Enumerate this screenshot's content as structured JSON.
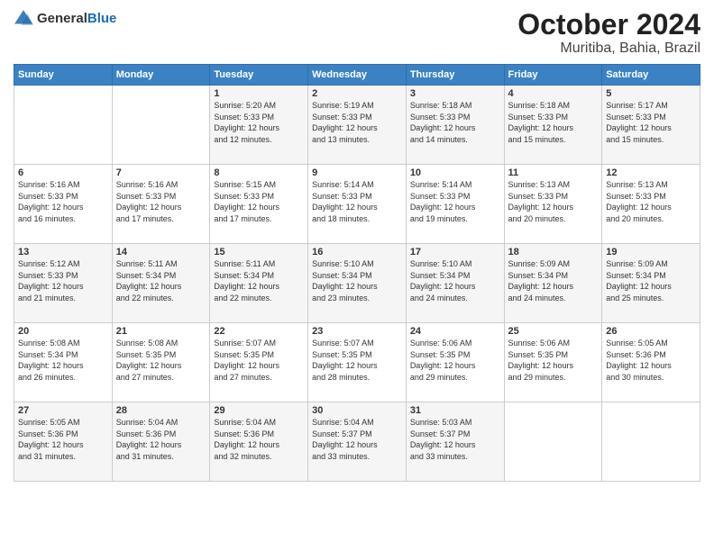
{
  "logo": {
    "text_general": "General",
    "text_blue": "Blue"
  },
  "header": {
    "month": "October 2024",
    "location": "Muritiba, Bahia, Brazil"
  },
  "days_of_week": [
    "Sunday",
    "Monday",
    "Tuesday",
    "Wednesday",
    "Thursday",
    "Friday",
    "Saturday"
  ],
  "weeks": [
    [
      {
        "day": "",
        "info": ""
      },
      {
        "day": "",
        "info": ""
      },
      {
        "day": "1",
        "info": "Sunrise: 5:20 AM\nSunset: 5:33 PM\nDaylight: 12 hours\nand 12 minutes."
      },
      {
        "day": "2",
        "info": "Sunrise: 5:19 AM\nSunset: 5:33 PM\nDaylight: 12 hours\nand 13 minutes."
      },
      {
        "day": "3",
        "info": "Sunrise: 5:18 AM\nSunset: 5:33 PM\nDaylight: 12 hours\nand 14 minutes."
      },
      {
        "day": "4",
        "info": "Sunrise: 5:18 AM\nSunset: 5:33 PM\nDaylight: 12 hours\nand 15 minutes."
      },
      {
        "day": "5",
        "info": "Sunrise: 5:17 AM\nSunset: 5:33 PM\nDaylight: 12 hours\nand 15 minutes."
      }
    ],
    [
      {
        "day": "6",
        "info": "Sunrise: 5:16 AM\nSunset: 5:33 PM\nDaylight: 12 hours\nand 16 minutes."
      },
      {
        "day": "7",
        "info": "Sunrise: 5:16 AM\nSunset: 5:33 PM\nDaylight: 12 hours\nand 17 minutes."
      },
      {
        "day": "8",
        "info": "Sunrise: 5:15 AM\nSunset: 5:33 PM\nDaylight: 12 hours\nand 17 minutes."
      },
      {
        "day": "9",
        "info": "Sunrise: 5:14 AM\nSunset: 5:33 PM\nDaylight: 12 hours\nand 18 minutes."
      },
      {
        "day": "10",
        "info": "Sunrise: 5:14 AM\nSunset: 5:33 PM\nDaylight: 12 hours\nand 19 minutes."
      },
      {
        "day": "11",
        "info": "Sunrise: 5:13 AM\nSunset: 5:33 PM\nDaylight: 12 hours\nand 20 minutes."
      },
      {
        "day": "12",
        "info": "Sunrise: 5:13 AM\nSunset: 5:33 PM\nDaylight: 12 hours\nand 20 minutes."
      }
    ],
    [
      {
        "day": "13",
        "info": "Sunrise: 5:12 AM\nSunset: 5:33 PM\nDaylight: 12 hours\nand 21 minutes."
      },
      {
        "day": "14",
        "info": "Sunrise: 5:11 AM\nSunset: 5:34 PM\nDaylight: 12 hours\nand 22 minutes."
      },
      {
        "day": "15",
        "info": "Sunrise: 5:11 AM\nSunset: 5:34 PM\nDaylight: 12 hours\nand 22 minutes."
      },
      {
        "day": "16",
        "info": "Sunrise: 5:10 AM\nSunset: 5:34 PM\nDaylight: 12 hours\nand 23 minutes."
      },
      {
        "day": "17",
        "info": "Sunrise: 5:10 AM\nSunset: 5:34 PM\nDaylight: 12 hours\nand 24 minutes."
      },
      {
        "day": "18",
        "info": "Sunrise: 5:09 AM\nSunset: 5:34 PM\nDaylight: 12 hours\nand 24 minutes."
      },
      {
        "day": "19",
        "info": "Sunrise: 5:09 AM\nSunset: 5:34 PM\nDaylight: 12 hours\nand 25 minutes."
      }
    ],
    [
      {
        "day": "20",
        "info": "Sunrise: 5:08 AM\nSunset: 5:34 PM\nDaylight: 12 hours\nand 26 minutes."
      },
      {
        "day": "21",
        "info": "Sunrise: 5:08 AM\nSunset: 5:35 PM\nDaylight: 12 hours\nand 27 minutes."
      },
      {
        "day": "22",
        "info": "Sunrise: 5:07 AM\nSunset: 5:35 PM\nDaylight: 12 hours\nand 27 minutes."
      },
      {
        "day": "23",
        "info": "Sunrise: 5:07 AM\nSunset: 5:35 PM\nDaylight: 12 hours\nand 28 minutes."
      },
      {
        "day": "24",
        "info": "Sunrise: 5:06 AM\nSunset: 5:35 PM\nDaylight: 12 hours\nand 29 minutes."
      },
      {
        "day": "25",
        "info": "Sunrise: 5:06 AM\nSunset: 5:35 PM\nDaylight: 12 hours\nand 29 minutes."
      },
      {
        "day": "26",
        "info": "Sunrise: 5:05 AM\nSunset: 5:36 PM\nDaylight: 12 hours\nand 30 minutes."
      }
    ],
    [
      {
        "day": "27",
        "info": "Sunrise: 5:05 AM\nSunset: 5:36 PM\nDaylight: 12 hours\nand 31 minutes."
      },
      {
        "day": "28",
        "info": "Sunrise: 5:04 AM\nSunset: 5:36 PM\nDaylight: 12 hours\nand 31 minutes."
      },
      {
        "day": "29",
        "info": "Sunrise: 5:04 AM\nSunset: 5:36 PM\nDaylight: 12 hours\nand 32 minutes."
      },
      {
        "day": "30",
        "info": "Sunrise: 5:04 AM\nSunset: 5:37 PM\nDaylight: 12 hours\nand 33 minutes."
      },
      {
        "day": "31",
        "info": "Sunrise: 5:03 AM\nSunset: 5:37 PM\nDaylight: 12 hours\nand 33 minutes."
      },
      {
        "day": "",
        "info": ""
      },
      {
        "day": "",
        "info": ""
      }
    ]
  ]
}
